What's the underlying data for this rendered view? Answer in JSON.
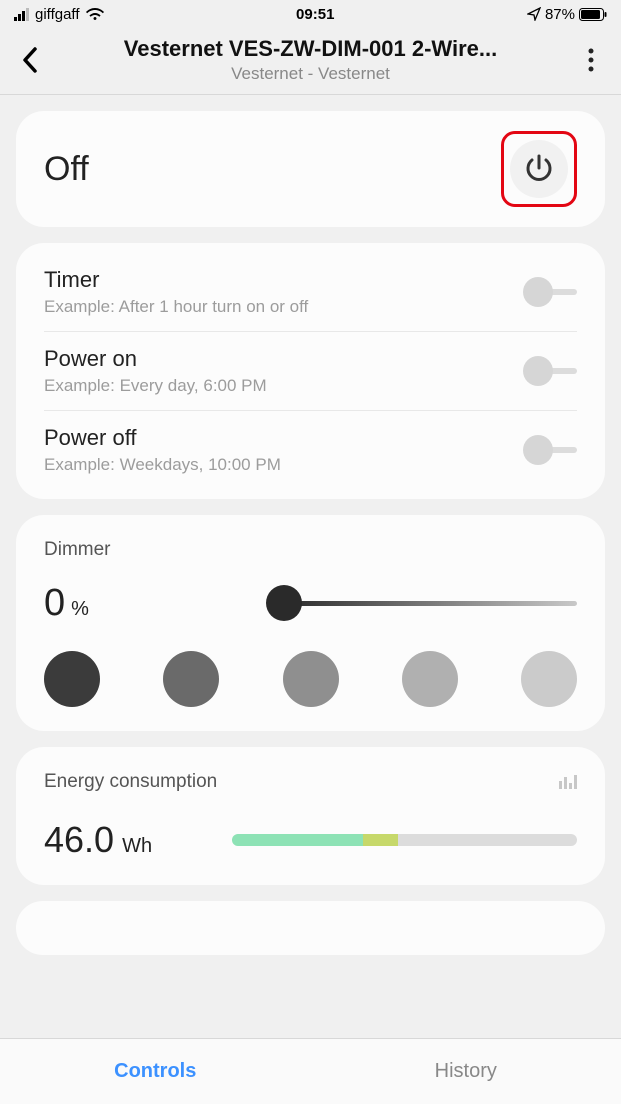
{
  "status_bar": {
    "carrier": "giffgaff",
    "time": "09:51",
    "battery": "87%"
  },
  "header": {
    "title": "Vesternet VES-ZW-DIM-001 2-Wire...",
    "subtitle": "Vesternet - Vesternet"
  },
  "power": {
    "state": "Off"
  },
  "schedules": [
    {
      "title": "Timer",
      "subtitle": "Example: After 1 hour turn on or off",
      "enabled": false
    },
    {
      "title": "Power on",
      "subtitle": "Example: Every day, 6:00 PM",
      "enabled": false
    },
    {
      "title": "Power off",
      "subtitle": "Example: Weekdays, 10:00 PM",
      "enabled": false
    }
  ],
  "dimmer": {
    "label": "Dimmer",
    "value": "0",
    "unit": "%",
    "preset_colors": [
      "#3b3b3b",
      "#6a6a6a",
      "#8f8f8f",
      "#b0b0b0",
      "#cbcbcb"
    ]
  },
  "energy": {
    "label": "Energy consumption",
    "value": "46.0",
    "unit": "Wh"
  },
  "tabs": {
    "controls": "Controls",
    "history": "History"
  }
}
